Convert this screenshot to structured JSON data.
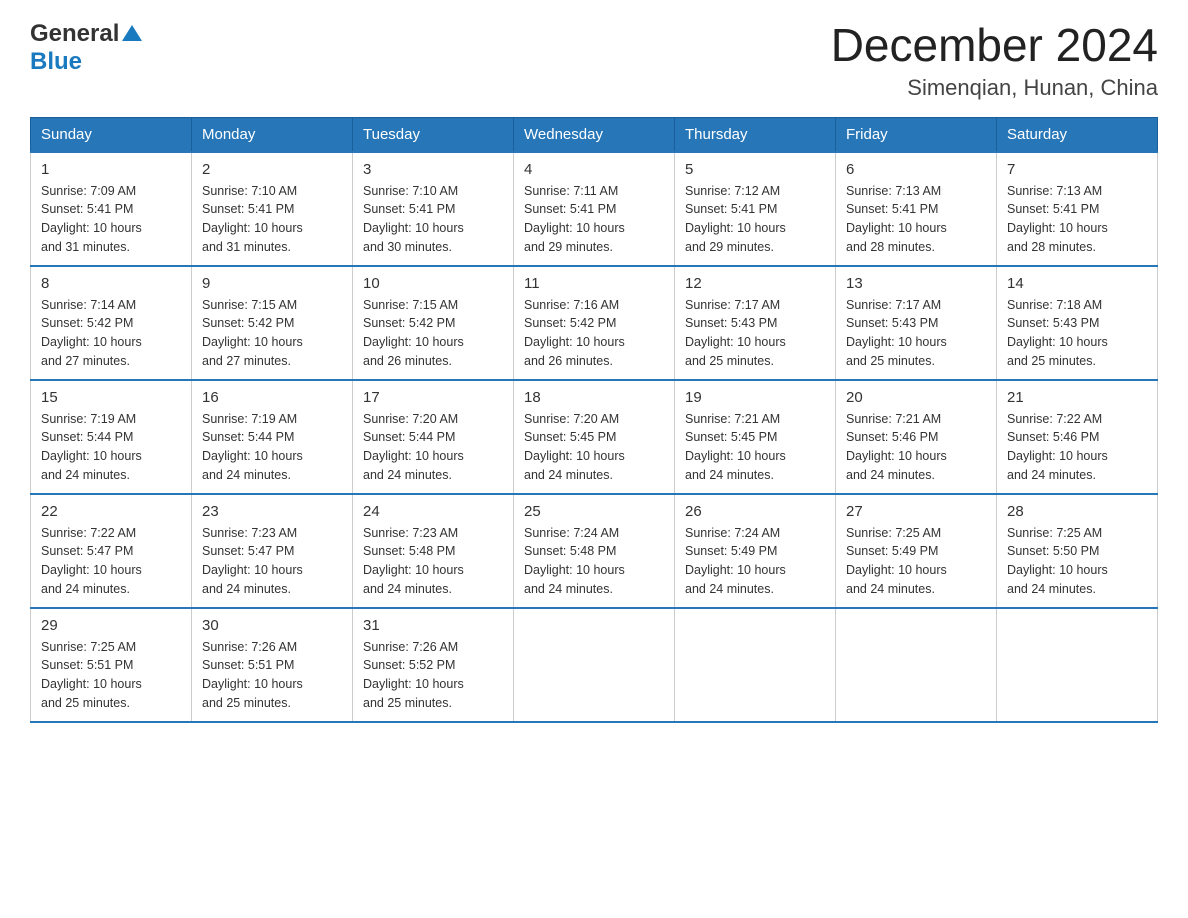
{
  "logo": {
    "general": "General",
    "blue": "Blue"
  },
  "header": {
    "month": "December 2024",
    "location": "Simenqian, Hunan, China"
  },
  "days_of_week": [
    "Sunday",
    "Monday",
    "Tuesday",
    "Wednesday",
    "Thursday",
    "Friday",
    "Saturday"
  ],
  "weeks": [
    [
      {
        "day": "1",
        "sunrise": "7:09 AM",
        "sunset": "5:41 PM",
        "daylight": "10 hours and 31 minutes."
      },
      {
        "day": "2",
        "sunrise": "7:10 AM",
        "sunset": "5:41 PM",
        "daylight": "10 hours and 31 minutes."
      },
      {
        "day": "3",
        "sunrise": "7:10 AM",
        "sunset": "5:41 PM",
        "daylight": "10 hours and 30 minutes."
      },
      {
        "day": "4",
        "sunrise": "7:11 AM",
        "sunset": "5:41 PM",
        "daylight": "10 hours and 29 minutes."
      },
      {
        "day": "5",
        "sunrise": "7:12 AM",
        "sunset": "5:41 PM",
        "daylight": "10 hours and 29 minutes."
      },
      {
        "day": "6",
        "sunrise": "7:13 AM",
        "sunset": "5:41 PM",
        "daylight": "10 hours and 28 minutes."
      },
      {
        "day": "7",
        "sunrise": "7:13 AM",
        "sunset": "5:41 PM",
        "daylight": "10 hours and 28 minutes."
      }
    ],
    [
      {
        "day": "8",
        "sunrise": "7:14 AM",
        "sunset": "5:42 PM",
        "daylight": "10 hours and 27 minutes."
      },
      {
        "day": "9",
        "sunrise": "7:15 AM",
        "sunset": "5:42 PM",
        "daylight": "10 hours and 27 minutes."
      },
      {
        "day": "10",
        "sunrise": "7:15 AM",
        "sunset": "5:42 PM",
        "daylight": "10 hours and 26 minutes."
      },
      {
        "day": "11",
        "sunrise": "7:16 AM",
        "sunset": "5:42 PM",
        "daylight": "10 hours and 26 minutes."
      },
      {
        "day": "12",
        "sunrise": "7:17 AM",
        "sunset": "5:43 PM",
        "daylight": "10 hours and 25 minutes."
      },
      {
        "day": "13",
        "sunrise": "7:17 AM",
        "sunset": "5:43 PM",
        "daylight": "10 hours and 25 minutes."
      },
      {
        "day": "14",
        "sunrise": "7:18 AM",
        "sunset": "5:43 PM",
        "daylight": "10 hours and 25 minutes."
      }
    ],
    [
      {
        "day": "15",
        "sunrise": "7:19 AM",
        "sunset": "5:44 PM",
        "daylight": "10 hours and 24 minutes."
      },
      {
        "day": "16",
        "sunrise": "7:19 AM",
        "sunset": "5:44 PM",
        "daylight": "10 hours and 24 minutes."
      },
      {
        "day": "17",
        "sunrise": "7:20 AM",
        "sunset": "5:44 PM",
        "daylight": "10 hours and 24 minutes."
      },
      {
        "day": "18",
        "sunrise": "7:20 AM",
        "sunset": "5:45 PM",
        "daylight": "10 hours and 24 minutes."
      },
      {
        "day": "19",
        "sunrise": "7:21 AM",
        "sunset": "5:45 PM",
        "daylight": "10 hours and 24 minutes."
      },
      {
        "day": "20",
        "sunrise": "7:21 AM",
        "sunset": "5:46 PM",
        "daylight": "10 hours and 24 minutes."
      },
      {
        "day": "21",
        "sunrise": "7:22 AM",
        "sunset": "5:46 PM",
        "daylight": "10 hours and 24 minutes."
      }
    ],
    [
      {
        "day": "22",
        "sunrise": "7:22 AM",
        "sunset": "5:47 PM",
        "daylight": "10 hours and 24 minutes."
      },
      {
        "day": "23",
        "sunrise": "7:23 AM",
        "sunset": "5:47 PM",
        "daylight": "10 hours and 24 minutes."
      },
      {
        "day": "24",
        "sunrise": "7:23 AM",
        "sunset": "5:48 PM",
        "daylight": "10 hours and 24 minutes."
      },
      {
        "day": "25",
        "sunrise": "7:24 AM",
        "sunset": "5:48 PM",
        "daylight": "10 hours and 24 minutes."
      },
      {
        "day": "26",
        "sunrise": "7:24 AM",
        "sunset": "5:49 PM",
        "daylight": "10 hours and 24 minutes."
      },
      {
        "day": "27",
        "sunrise": "7:25 AM",
        "sunset": "5:49 PM",
        "daylight": "10 hours and 24 minutes."
      },
      {
        "day": "28",
        "sunrise": "7:25 AM",
        "sunset": "5:50 PM",
        "daylight": "10 hours and 24 minutes."
      }
    ],
    [
      {
        "day": "29",
        "sunrise": "7:25 AM",
        "sunset": "5:51 PM",
        "daylight": "10 hours and 25 minutes."
      },
      {
        "day": "30",
        "sunrise": "7:26 AM",
        "sunset": "5:51 PM",
        "daylight": "10 hours and 25 minutes."
      },
      {
        "day": "31",
        "sunrise": "7:26 AM",
        "sunset": "5:52 PM",
        "daylight": "10 hours and 25 minutes."
      },
      null,
      null,
      null,
      null
    ]
  ],
  "labels": {
    "sunrise": "Sunrise:",
    "sunset": "Sunset:",
    "daylight": "Daylight:"
  }
}
